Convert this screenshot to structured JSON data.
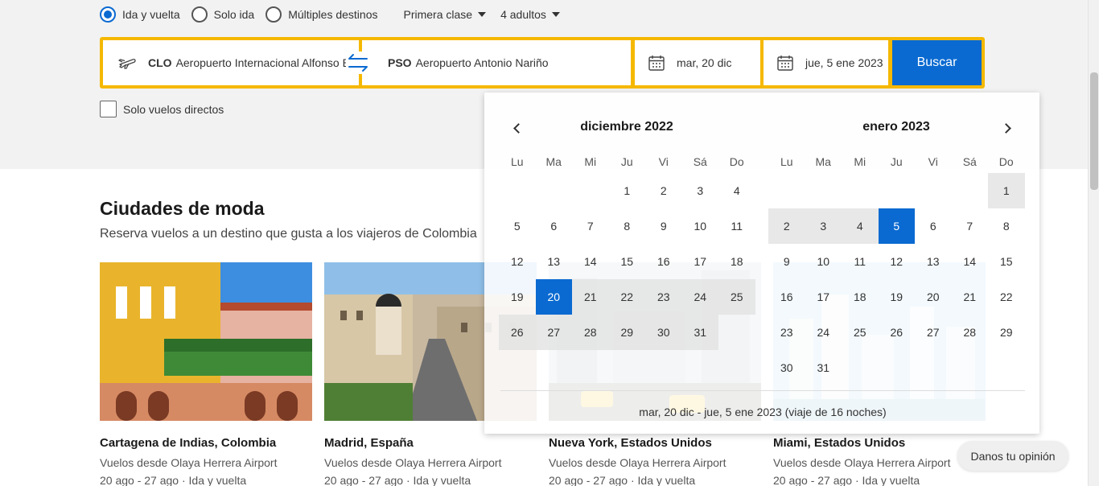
{
  "trip_type": {
    "options": [
      "Ida y vuelta",
      "Solo ida",
      "Múltiples destinos"
    ],
    "selected": "Ida y vuelta",
    "cabin_class": "Primera clase",
    "travelers": "4 adultos"
  },
  "search": {
    "origin_code": "CLO",
    "origin_name": "Aeropuerto Internacional Alfonso Bonilla Aragón",
    "destination_code": "PSO",
    "destination_name": "Aeropuerto Antonio Nariño",
    "departure_date": "mar, 20 dic",
    "return_date": "jue, 5 ene 2023",
    "search_label": "Buscar",
    "direct_only_label": "Solo vuelos directos"
  },
  "trending": {
    "title": "Ciudades de moda",
    "subtitle": "Reserva vuelos a un destino que gusta a los viajeros de Colombia",
    "cards": [
      {
        "title": "Cartagena de Indias, Colombia",
        "from": "Vuelos desde Olaya Herrera Airport",
        "dates": "20 ago - 27 ago · Ida y vuelta"
      },
      {
        "title": "Madrid, España",
        "from": "Vuelos desde Olaya Herrera Airport",
        "dates": "20 ago - 27 ago · Ida y vuelta"
      },
      {
        "title": "Nueva York, Estados Unidos",
        "from": "Vuelos desde Olaya Herrera Airport",
        "dates": "20 ago - 27 ago · Ida y vuelta"
      },
      {
        "title": "Miami, Estados Unidos",
        "from": "Vuelos desde Olaya Herrera Airport",
        "dates": "20 ago - 27 ago · Ida y vuelta"
      }
    ]
  },
  "calendar": {
    "weekdays": [
      "Lu",
      "Ma",
      "Mi",
      "Ju",
      "Vi",
      "Sá",
      "Do"
    ],
    "months": [
      {
        "title": "diciembre 2022",
        "offset": 3,
        "days": 31,
        "selected": [
          20
        ],
        "range_from": 21,
        "range_to": 31
      },
      {
        "title": "enero 2023",
        "offset": 6,
        "days": 31,
        "selected": [
          5
        ],
        "range_from": 1,
        "range_to": 4
      }
    ],
    "summary": "mar, 20 dic - jue, 5 ene 2023 (viaje de 16 noches)"
  },
  "feedback_label": "Danos tu opinión",
  "colors": {
    "accent": "#0a6ad1",
    "search_border": "#f5b800"
  }
}
